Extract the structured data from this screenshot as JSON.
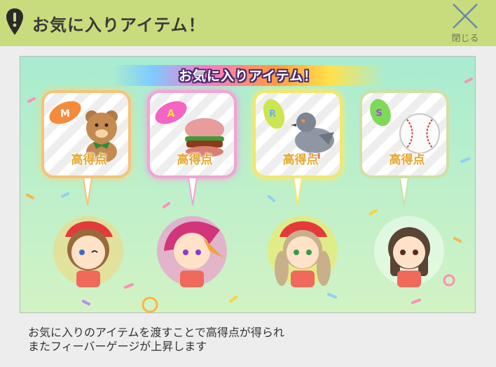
{
  "header": {
    "title": "お気に入りアイテム！",
    "close_label": "閉じる",
    "bar_color": "#c9dc7d"
  },
  "banner": {
    "text": "お気に入りアイテム！"
  },
  "cards": [
    {
      "rank_icon": "letter-m-icon",
      "item": "teddy-bear-icon",
      "score_label": "高得点",
      "frame_color": "#f7b86a"
    },
    {
      "rank_icon": "letter-a-icon",
      "item": "hamburger-icon",
      "score_label": "高得点",
      "frame_color": "#f29bd2"
    },
    {
      "rank_icon": "letter-r-icon",
      "item": "pigeon-icon",
      "score_label": "高得点",
      "frame_color": "#f3e56a"
    },
    {
      "rank_icon": "letter-s-icon",
      "item": "baseball-icon",
      "score_label": "高得点",
      "frame_color": "#c8d99a"
    }
  ],
  "characters": [
    {
      "name": "chara-1",
      "glow": "#ffb03a"
    },
    {
      "name": "chara-2",
      "glow": "#ff5fc8"
    },
    {
      "name": "chara-3",
      "glow": "#ffe23a"
    },
    {
      "name": "chara-4",
      "glow": "#ffffff"
    }
  ],
  "footer": {
    "line1": "お気に入りのアイテムを渡すことで高得点が得られ",
    "line2": "またフィーバーゲージが上昇します"
  }
}
